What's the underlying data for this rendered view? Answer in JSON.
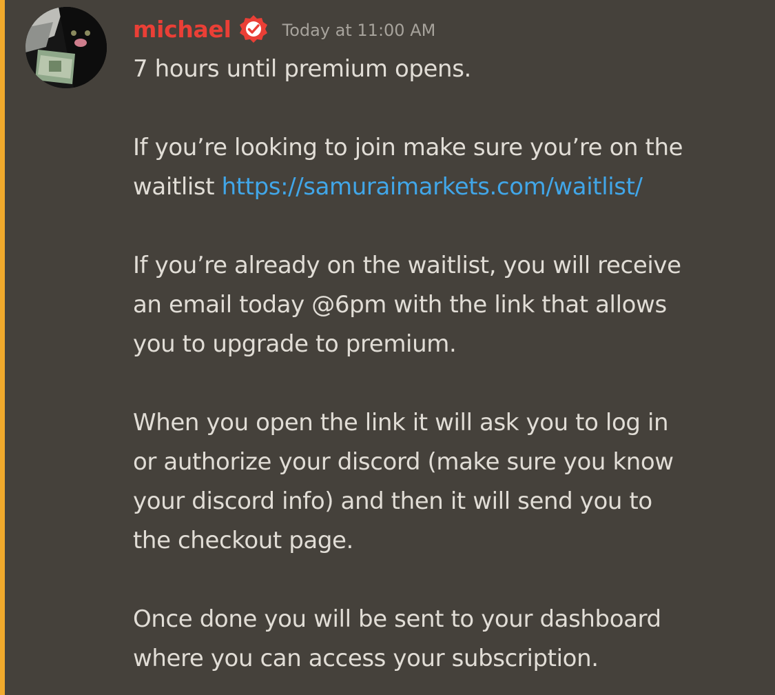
{
  "message": {
    "author": "michael",
    "timestamp": "Today at 11:00 AM",
    "avatar_icon": "black-cat-holding-money-avatar",
    "verified_badge_icon": "verified-check-badge-icon",
    "colors": {
      "background": "#45413b",
      "accent_bar": "#f0a92c",
      "username": "#ea3f36",
      "link": "#41a6e8",
      "text": "#e1ddd6",
      "timestamp": "#a7a39c"
    },
    "lines": [
      "7 hours until premium opens.",
      "",
      "If you’re looking to join make sure you’re on the",
      "waitlist",
      "",
      "If you’re already on the waitlist, you will receive",
      "an email today @6pm with the link that allows",
      "you to upgrade to premium.",
      "",
      "When you open the link it will ask you to log in",
      "or authorize your discord (make sure you know",
      "your discord info) and then it will send you to",
      "the checkout page.",
      "",
      "Once done you will be sent to your dashboard",
      "where you can access your subscription."
    ],
    "link_text": "https://samuraimarkets.com/waitlist/"
  }
}
